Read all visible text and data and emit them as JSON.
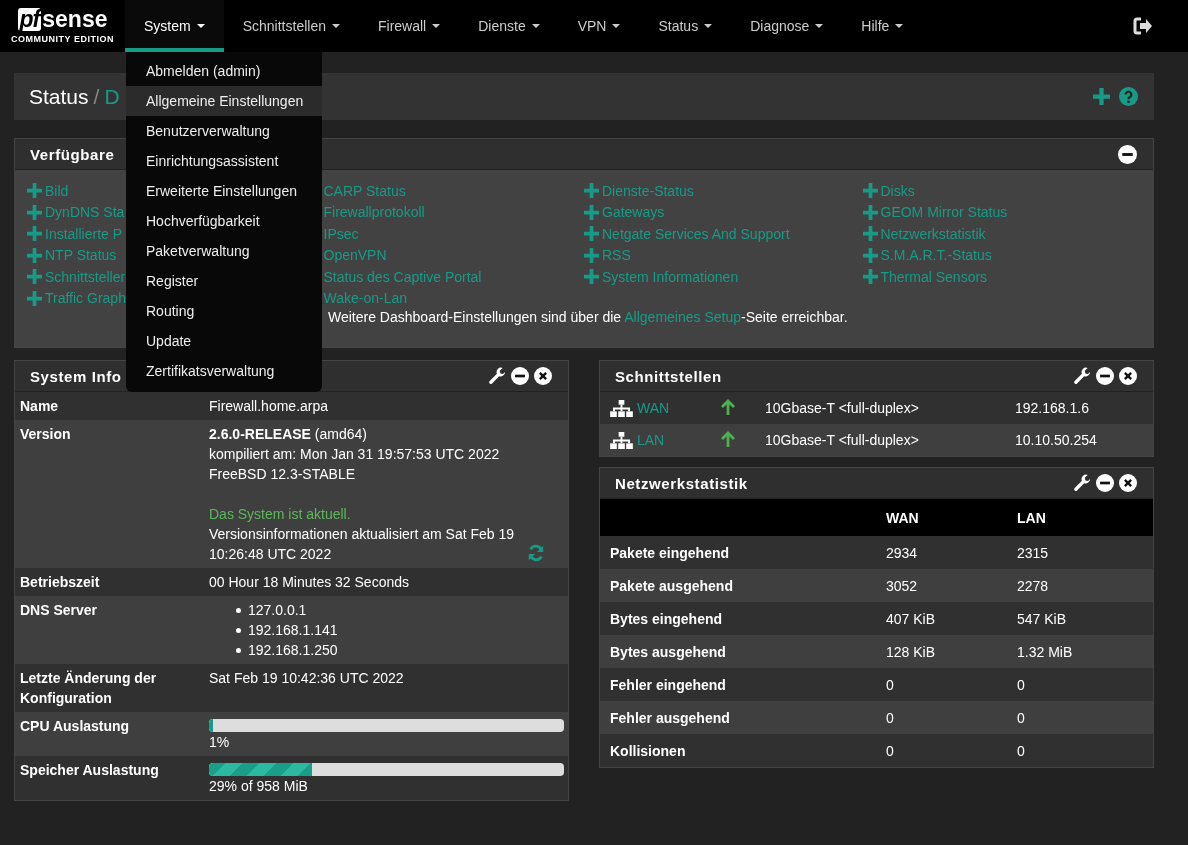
{
  "logo": {
    "mark": "pf",
    "word": "sense",
    "edition": "COMMUNITY EDITION"
  },
  "nav": [
    {
      "label": "System",
      "selected": true
    },
    {
      "label": "Schnittstellen",
      "selected": false
    },
    {
      "label": "Firewall",
      "selected": false
    },
    {
      "label": "Dienste",
      "selected": false
    },
    {
      "label": "VPN",
      "selected": false
    },
    {
      "label": "Status",
      "selected": false
    },
    {
      "label": "Diagnose",
      "selected": false
    },
    {
      "label": "Hilfe",
      "selected": false
    }
  ],
  "menu": [
    {
      "label": "Abmelden (admin)",
      "selected": false
    },
    {
      "label": "Allgemeine Einstellungen",
      "selected": true
    },
    {
      "label": "Benutzerverwaltung",
      "selected": false
    },
    {
      "label": "Einrichtungsassistent",
      "selected": false
    },
    {
      "label": "Erweiterte Einstellungen",
      "selected": false
    },
    {
      "label": "Hochverfügbarkeit",
      "selected": false
    },
    {
      "label": "Paketverwaltung",
      "selected": false
    },
    {
      "label": "Register",
      "selected": false
    },
    {
      "label": "Routing",
      "selected": false
    },
    {
      "label": "Update",
      "selected": false
    },
    {
      "label": "Zertifikatsverwaltung",
      "selected": false
    }
  ],
  "breadcrumb": {
    "section": "Status",
    "separator": "/",
    "page": "D"
  },
  "widgets": {
    "title": "Verfügbare",
    "columns": [
      [
        "Bild",
        "DynDNS Sta",
        "Installierte P",
        "NTP Status",
        "Schnittsteller",
        "Traffic Graph"
      ],
      [
        "CARP Status",
        "Firewallprotokoll",
        "IPsec",
        "OpenVPN",
        "Status des Captive Portal",
        "Wake-on-Lan"
      ],
      [
        "Dienste-Status",
        "Gateways",
        "Netgate Services And Support",
        "RSS",
        "System Informationen"
      ],
      [
        "Disks",
        "GEOM Mirror Status",
        "Netzwerkstatistik",
        "S.M.A.R.T.-Status",
        "Thermal Sensors"
      ]
    ],
    "note_before": "Weitere Dashboard-Einstellungen sind über die ",
    "note_link": "Allgemeines Setup",
    "note_after": "-Seite erreichbar."
  },
  "system_info": {
    "title": "System Info",
    "rows": [
      {
        "kind": "text",
        "label": "Name",
        "value": "Firewall.home.arpa"
      },
      {
        "kind": "version",
        "label": "Version",
        "lines": [
          "**2.6.0-RELEASE** (amd64)",
          "kompiliert am: Mon Jan 31 19:57:53 UTC 2022",
          "FreeBSD 12.3-STABLE"
        ],
        "status": "Das System ist aktuell.",
        "checked": "Versionsinformationen aktualisiert am Sat Feb 19 10:26:48 UTC 2022"
      },
      {
        "kind": "text",
        "label": "Betriebszeit",
        "value": "00 Hour 18 Minutes 32 Seconds"
      },
      {
        "kind": "list",
        "label": "DNS Server",
        "items": [
          "127.0.0.1",
          "192.168.1.141",
          "192.168.1.250"
        ]
      },
      {
        "kind": "text",
        "label": "Letzte Änderung der Konfiguration",
        "value": "Sat Feb 19 10:42:36 UTC 2022"
      },
      {
        "kind": "bar",
        "label": "CPU Auslastung",
        "level": 0.01,
        "reading": "1%"
      },
      {
        "kind": "bar",
        "label": "Speicher Auslastung",
        "level": 0.29,
        "reading": "29% of 958 MiB",
        "striped": true
      }
    ]
  },
  "interfaces": {
    "title": "Schnittstellen",
    "rows": [
      {
        "name": "WAN",
        "up": true,
        "media": "10Gbase-T <full-duplex>",
        "ip": "192.168.1.6"
      },
      {
        "name": "LAN",
        "up": true,
        "media": "10Gbase-T <full-duplex>",
        "ip": "10.10.50.254"
      }
    ]
  },
  "netstats": {
    "title": "Netzwerkstatistik",
    "columns": [
      "WAN",
      "LAN"
    ],
    "rows": [
      {
        "label": "Pakete eingehend",
        "values": [
          "2934",
          "2315"
        ]
      },
      {
        "label": "Pakete ausgehend",
        "values": [
          "3052",
          "2278"
        ]
      },
      {
        "label": "Bytes eingehend",
        "values": [
          "407 KiB",
          "547 KiB"
        ]
      },
      {
        "label": "Bytes ausgehend",
        "values": [
          "128 KiB",
          "1.32 MiB"
        ]
      },
      {
        "label": "Fehler eingehend",
        "values": [
          "0",
          "0"
        ]
      },
      {
        "label": "Fehler ausgehend",
        "values": [
          "0",
          "0"
        ]
      },
      {
        "label": "Kollisionen",
        "values": [
          "0",
          "0"
        ]
      }
    ]
  }
}
